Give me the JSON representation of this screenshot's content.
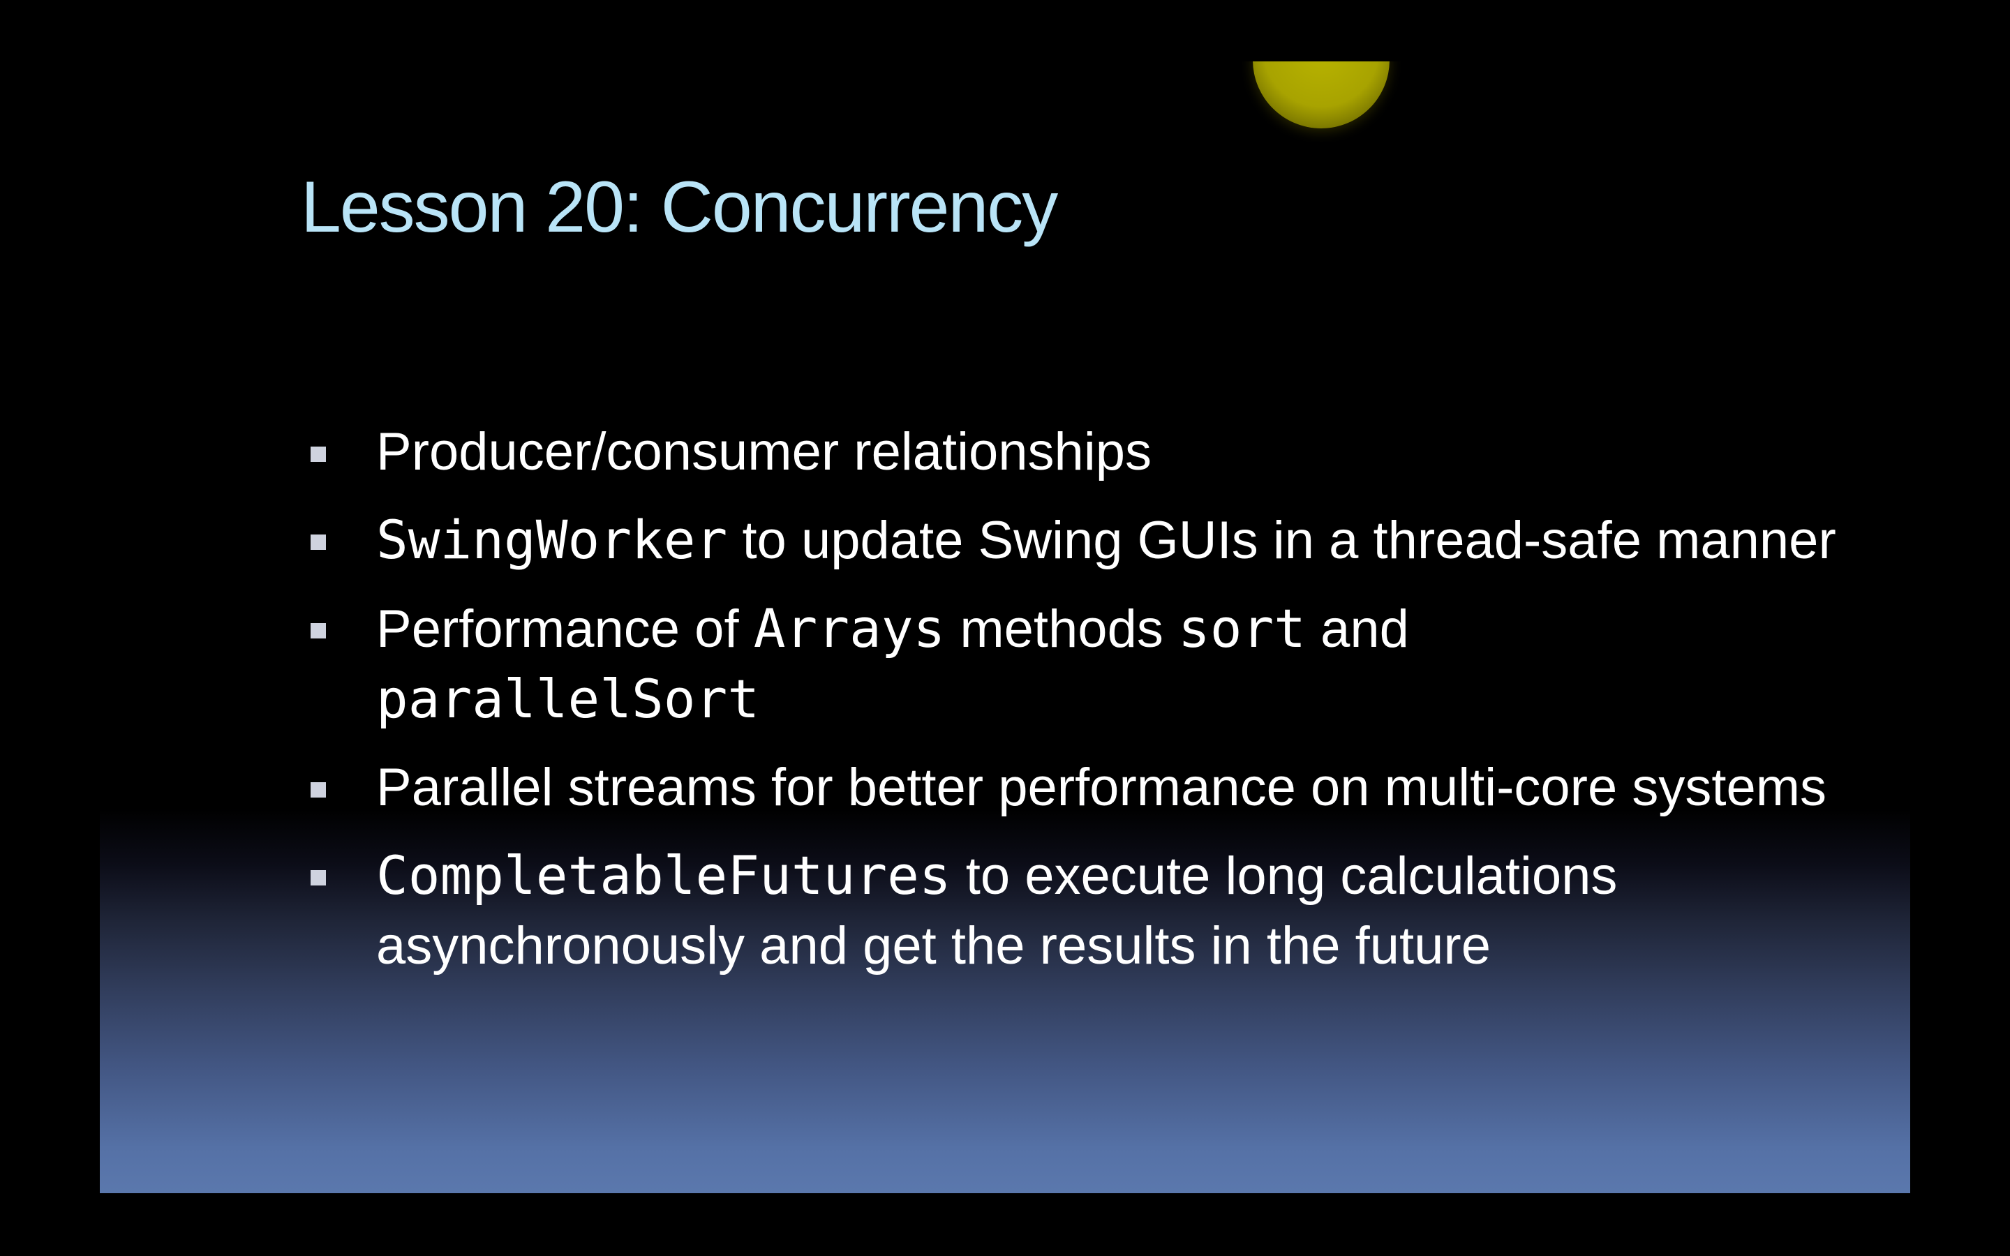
{
  "slide": {
    "title": "Lesson 20: Concurrency",
    "colors": {
      "title": "#b9e4f7",
      "text": "#ffffff",
      "sun": "#a8a300",
      "gradient_bottom": "#5b78ad"
    },
    "decoration": "sun-circle",
    "bullets": [
      {
        "text": "Producer/consumer relationships"
      },
      {
        "code1": "SwingWorker",
        "text": " to update Swing GUIs in a thread-safe manner"
      },
      {
        "text1": "Performance of ",
        "code1": "Arrays",
        "text2": " methods ",
        "code2": "sort",
        "text3": " and ",
        "code3": "parallelSort"
      },
      {
        "text": "Parallel streams for better performance on multi-core systems"
      },
      {
        "code1": "CompletableFutures",
        "text": " to execute long calculations asynchronously and get the results in the future"
      }
    ]
  }
}
